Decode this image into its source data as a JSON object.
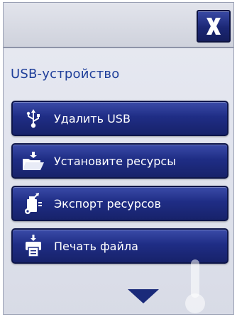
{
  "header": {
    "close_label": "X"
  },
  "section": {
    "title": "USB-устройство"
  },
  "menu": {
    "items": [
      {
        "label": "Удалить USB",
        "icon": "usb-icon"
      },
      {
        "label": "Установите ресурсы",
        "icon": "folder-open-icon"
      },
      {
        "label": "Экспорт ресурсов",
        "icon": "export-resources-icon"
      },
      {
        "label": "Печать файла",
        "icon": "print-file-icon"
      }
    ]
  },
  "footer": {
    "scroll_icon": "scroll-down-arrow-icon"
  },
  "colors": {
    "button_blue": "#1f2d85",
    "title_blue": "#1f3f9a",
    "background": "#dfe2ec"
  }
}
